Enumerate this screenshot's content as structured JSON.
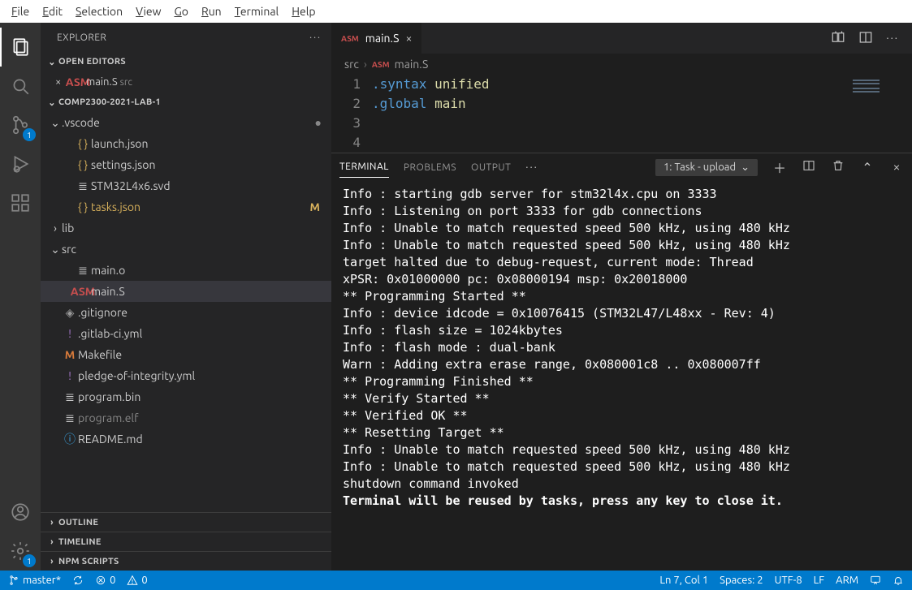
{
  "menubar": [
    "File",
    "Edit",
    "Selection",
    "View",
    "Go",
    "Run",
    "Terminal",
    "Help"
  ],
  "explorer": {
    "title": "EXPLORER",
    "open_editors_label": "OPEN EDITORS",
    "open_editor": {
      "name": "main.S",
      "hint": "src"
    },
    "project": "COMP2300-2021-LAB-1",
    "tree": [
      {
        "depth": 0,
        "kind": "folder",
        "chev": "⌄",
        "name": ".vscode",
        "dot": true
      },
      {
        "depth": 1,
        "kind": "json",
        "name": "launch.json"
      },
      {
        "depth": 1,
        "kind": "json",
        "name": "settings.json"
      },
      {
        "depth": 1,
        "kind": "file",
        "name": "STM32L4x6.svd"
      },
      {
        "depth": 1,
        "kind": "json",
        "name": "tasks.json",
        "color": "yellow",
        "mod": "M"
      },
      {
        "depth": 0,
        "kind": "folder",
        "chev": "›",
        "name": "lib"
      },
      {
        "depth": 0,
        "kind": "folder",
        "chev": "⌄",
        "name": "src"
      },
      {
        "depth": 1,
        "kind": "file",
        "name": "main.o"
      },
      {
        "depth": 1,
        "kind": "asm",
        "name": "main.S",
        "active": true
      },
      {
        "depth": 0,
        "kind": "git",
        "name": ".gitignore"
      },
      {
        "depth": 0,
        "kind": "purple",
        "name": ".gitlab-ci.yml"
      },
      {
        "depth": 0,
        "kind": "mk",
        "name": "Makefile"
      },
      {
        "depth": 0,
        "kind": "purple",
        "name": "pledge-of-integrity.yml"
      },
      {
        "depth": 0,
        "kind": "file",
        "name": "program.bin"
      },
      {
        "depth": 0,
        "kind": "file",
        "name": "program.elf",
        "dim": true
      },
      {
        "depth": 0,
        "kind": "info",
        "name": "README.md"
      }
    ],
    "sections": [
      "OUTLINE",
      "TIMELINE",
      "NPM SCRIPTS"
    ]
  },
  "scm_badge": "1",
  "settings_badge": "1",
  "tab": {
    "name": "main.S"
  },
  "breadcrumb": {
    "dir": "src",
    "file": "main.S"
  },
  "code_lines": [
    {
      "n": "1",
      "p": ".syntax ",
      "k": "unified"
    },
    {
      "n": "2",
      "p": ".global ",
      "k": "main"
    },
    {
      "n": "3",
      "p": "",
      "k": ""
    },
    {
      "n": "4",
      "p": "",
      "k": ""
    }
  ],
  "panel": {
    "tabs": [
      "TERMINAL",
      "PROBLEMS",
      "OUTPUT"
    ],
    "task_label": "1: Task - upload"
  },
  "terminal_lines": [
    "Info : starting gdb server for stm32l4x.cpu on 3333",
    "Info : Listening on port 3333 for gdb connections",
    "Info : Unable to match requested speed 500 kHz, using 480 kHz",
    "Info : Unable to match requested speed 500 kHz, using 480 kHz",
    "target halted due to debug-request, current mode: Thread",
    "xPSR: 0x01000000 pc: 0x08000194 msp: 0x20018000",
    "** Programming Started **",
    "Info : device idcode = 0x10076415 (STM32L47/L48xx - Rev: 4)",
    "Info : flash size = 1024kbytes",
    "Info : flash mode : dual-bank",
    "Warn : Adding extra erase range, 0x080001c8 .. 0x080007ff",
    "** Programming Finished **",
    "** Verify Started **",
    "** Verified OK **",
    "** Resetting Target **",
    "Info : Unable to match requested speed 500 kHz, using 480 kHz",
    "Info : Unable to match requested speed 500 kHz, using 480 kHz",
    "shutdown command invoked",
    "",
    "Terminal will be reused by tasks, press any key to close it."
  ],
  "status": {
    "branch": "master*",
    "errors": "0",
    "warnings": "0",
    "pos": "Ln 7, Col 1",
    "spaces": "Spaces: 2",
    "encoding": "UTF-8",
    "eol": "LF",
    "lang": "ARM"
  }
}
